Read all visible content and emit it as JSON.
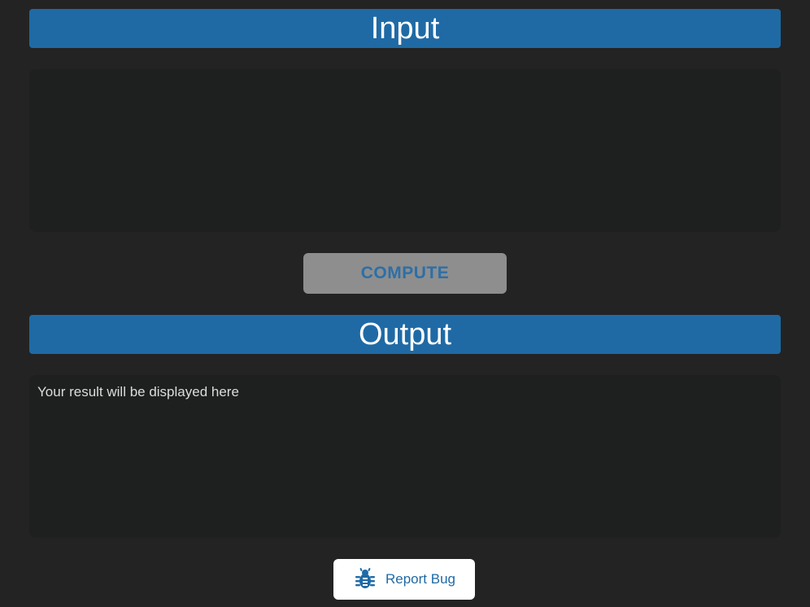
{
  "colors": {
    "accent": "#1f6aa5",
    "background": "#232323",
    "panel": "#1e1f1f",
    "button_disabled": "#8e8e8e"
  },
  "input": {
    "header": "Input",
    "value": ""
  },
  "compute": {
    "label": "COMPUTE"
  },
  "output": {
    "header": "Output",
    "placeholder": "Your result will be displayed here"
  },
  "report_bug": {
    "label": "Report Bug",
    "icon": "bug-icon"
  }
}
